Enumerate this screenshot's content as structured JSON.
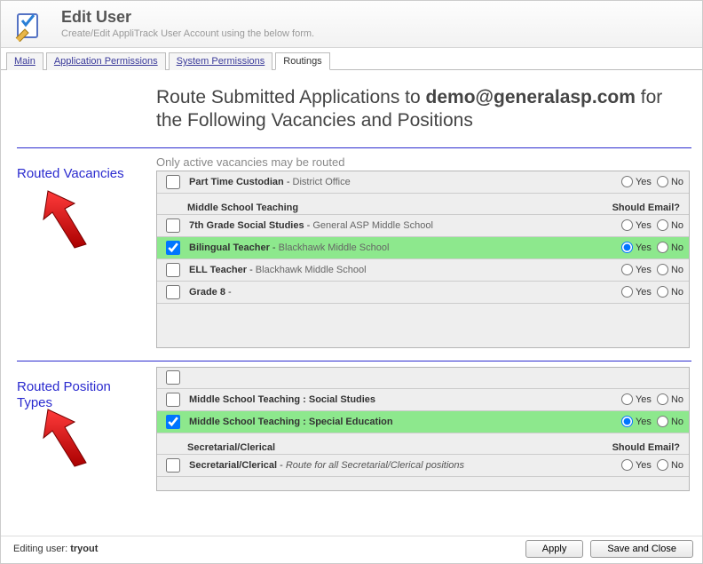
{
  "header": {
    "title": "Edit User",
    "subtitle": "Create/Edit AppliTrack User Account using the below form."
  },
  "tabs": [
    {
      "label": "Main",
      "active": false
    },
    {
      "label": "Application Permissions",
      "active": false
    },
    {
      "label": "System Permissions",
      "active": false
    },
    {
      "label": "Routings",
      "active": true
    }
  ],
  "routings": {
    "title_prefix": "Route Submitted Applications to ",
    "email": "demo@generalasp.com",
    "title_suffix": " for the Following Vacancies and Positions"
  },
  "sections": {
    "vacancies_label": "Routed Vacancies",
    "positions_label": "Routed Position Types",
    "vacancies_hint": "Only active vacancies may be routed",
    "should_email_header": "Should Email?"
  },
  "vacancies": {
    "top_row": {
      "title": "Part Time Custodian",
      "location": "District Office",
      "checked": false,
      "email": null
    },
    "group": "Middle School Teaching",
    "rows": [
      {
        "title": "7th Grade Social Studies",
        "location": "General ASP Middle School",
        "checked": false,
        "email": null,
        "hl": false
      },
      {
        "title": "Bilingual Teacher",
        "location": "Blackhawk Middle School",
        "checked": true,
        "email": "yes",
        "hl": true
      },
      {
        "title": "ELL Teacher",
        "location": "Blackhawk Middle School",
        "checked": false,
        "email": null,
        "hl": false
      },
      {
        "title": "Grade 8",
        "location": "",
        "checked": false,
        "email": null,
        "hl": false
      }
    ]
  },
  "positions": {
    "rows_top": [
      {
        "title": "Middle School Teaching : Social Studies",
        "checked": false,
        "email": null,
        "hl": false
      },
      {
        "title": "Middle School Teaching : Special Education",
        "checked": true,
        "email": "yes",
        "hl": true
      }
    ],
    "group": "Secretarial/Clerical",
    "rows_group": [
      {
        "title": "Secretarial/Clerical",
        "note": "Route for all Secretarial/Clerical positions",
        "checked": false,
        "email": null,
        "hl": false
      }
    ]
  },
  "yn": {
    "yes": "Yes",
    "no": "No"
  },
  "footer": {
    "label": "Editing user:",
    "user": "tryout",
    "apply": "Apply",
    "save": "Save and Close"
  }
}
